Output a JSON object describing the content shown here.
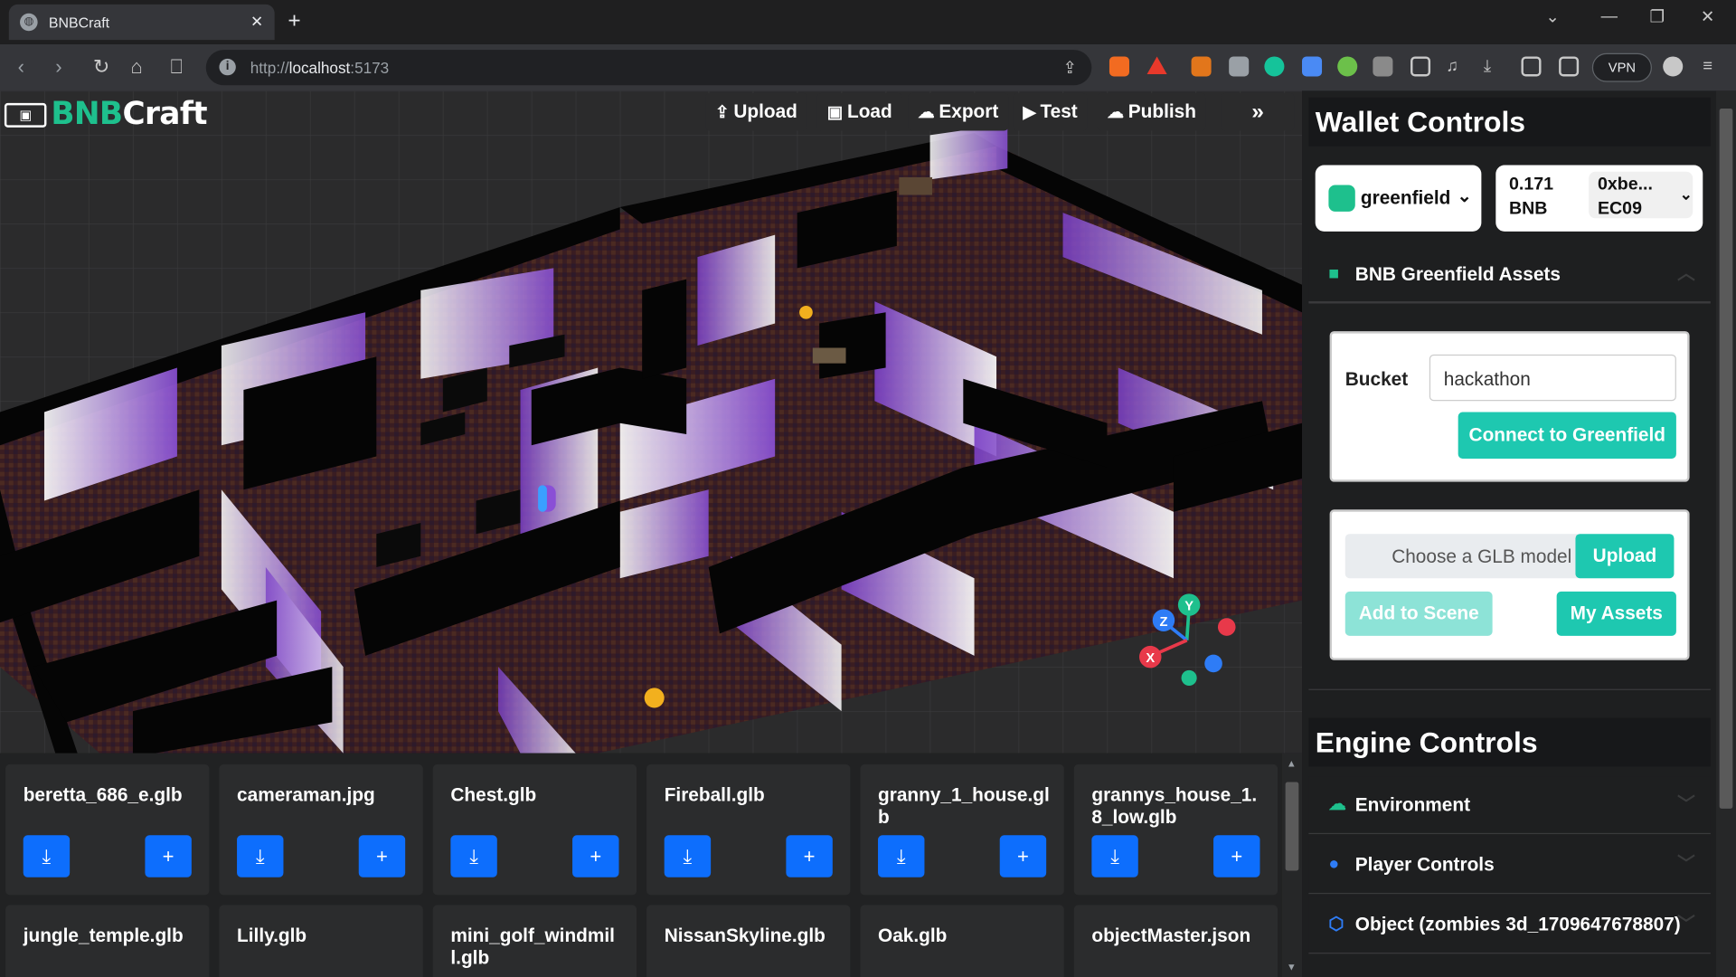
{
  "browser": {
    "tab_title": "BNBCraft",
    "url_host": "http://",
    "url_domain": "localhost",
    "url_port": ":5173",
    "vpn_label": "VPN"
  },
  "app": {
    "logo_prefix": "BNB",
    "logo_suffix": "Craft",
    "toolbar": [
      {
        "label": "Upload",
        "icon": "upload-icon"
      },
      {
        "label": "Load",
        "icon": "image-icon"
      },
      {
        "label": "Export",
        "icon": "cloud-download-icon"
      },
      {
        "label": "Test",
        "icon": "play-icon"
      },
      {
        "label": "Publish",
        "icon": "cloud-upload-icon"
      }
    ],
    "collapse_icon": "double-chevron-right-icon"
  },
  "axes_gizmo": {
    "x": "X",
    "y": "Y",
    "z": "Z"
  },
  "assets": [
    {
      "name": "beretta_686_e.glb"
    },
    {
      "name": "cameraman.jpg"
    },
    {
      "name": "Chest.glb"
    },
    {
      "name": "Fireball.glb"
    },
    {
      "name": "granny_1_house.glb"
    },
    {
      "name": "grannys_house_1.8_low.glb"
    },
    {
      "name": "jungle_temple.glb"
    },
    {
      "name": "Lilly.glb"
    },
    {
      "name": "mini_golf_windmill.glb"
    },
    {
      "name": "NissanSkyline.glb"
    },
    {
      "name": "Oak.glb"
    },
    {
      "name": "objectMaster.json"
    }
  ],
  "wallet": {
    "title": "Wallet Controls",
    "network": "greenfield",
    "balance_amount": "0.171",
    "balance_unit": "BNB",
    "address_line1": "0xbe...",
    "address_line2": "EC09",
    "greenfield_section": "BNB Greenfield Assets",
    "bucket_label": "Bucket",
    "bucket_value": "hackathon",
    "connect_button": "Connect to Greenfield",
    "file_placeholder": "Choose a GLB model",
    "upload_button": "Upload",
    "add_to_scene_button": "Add to Scene",
    "my_assets_button": "My Assets"
  },
  "engine": {
    "title": "Engine Controls",
    "sections": [
      {
        "label": "Environment",
        "icon": "cloud-icon",
        "color": "#1ec08d"
      },
      {
        "label": "Player Controls",
        "icon": "person-icon",
        "color": "#2e7cf6"
      },
      {
        "label": "Object (zombies 3d_1709647678807)",
        "icon": "cube-icon",
        "color": "#2e7cf6"
      }
    ]
  },
  "colors": {
    "accent_teal": "#1ec8b0",
    "button_blue": "#0d6efd",
    "brand_green": "#1ec08d",
    "wall_purple": "#8a4fd6"
  }
}
